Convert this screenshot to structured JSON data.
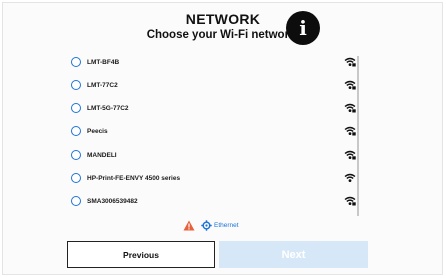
{
  "header": {
    "title": "NETWORK",
    "subtitle": "Choose your Wi-Fi network:"
  },
  "networks": [
    {
      "ssid": "LMT-BF4B",
      "signal": "wifi-lock-icon"
    },
    {
      "ssid": "LMT-77C2",
      "signal": "wifi-lock-icon"
    },
    {
      "ssid": "LMT-5G-77C2",
      "signal": "wifi-lock-icon"
    },
    {
      "ssid": "Peecis",
      "signal": "wifi-lock-icon"
    },
    {
      "ssid": "MANDELI",
      "signal": "wifi-lock-icon"
    },
    {
      "ssid": "HP-Print-FE-ENVY 4500 series",
      "signal": "wifi-icon"
    },
    {
      "ssid": "SMA3006539482",
      "signal": "wifi-lock-icon"
    }
  ],
  "ethernet": {
    "label": "Ethernet"
  },
  "buttons": {
    "previous": "Previous",
    "next": "Next"
  },
  "colors": {
    "accent": "#1e73d8",
    "next_disabled": "#d6e8f7"
  }
}
